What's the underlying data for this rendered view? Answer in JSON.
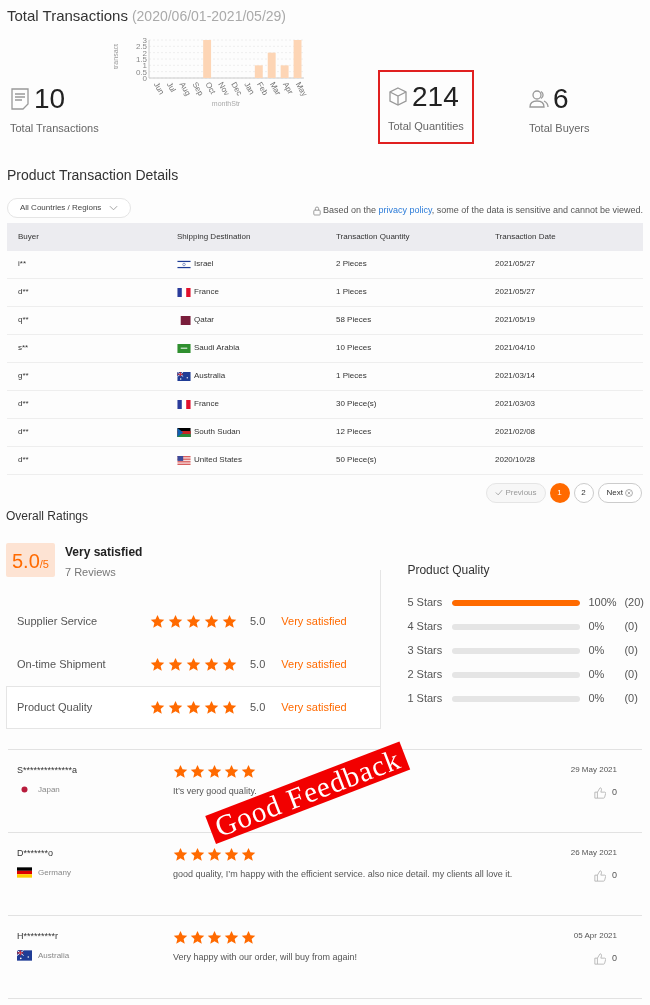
{
  "header": {
    "title": "Total Transactions",
    "range": "(2020/06/01-2021/05/29)"
  },
  "stats": [
    {
      "kind": "transactions",
      "value": "10",
      "label": "Total Transactions",
      "selected": false,
      "chart_data": {
        "type": "bar",
        "xlabel": "monthStr",
        "ylabel": "transact",
        "categories": [
          "Jun",
          "Jul",
          "Aug",
          "Sep",
          "Oct",
          "Nov",
          "Dec",
          "Jan",
          "Feb",
          "Mar",
          "Apr",
          "May"
        ],
        "grid": true,
        "series": [
          {
            "color": "#fdd5b5",
            "values": [
              0,
              0,
              0,
              0,
              3,
              0,
              0,
              0,
              1,
              2,
              1,
              3
            ]
          }
        ],
        "ylim": [
          0,
          3
        ],
        "yticks": [
          0,
          0.5,
          1,
          1.5,
          2,
          2.5,
          3
        ]
      }
    },
    {
      "kind": "quantities",
      "value": "214",
      "label": "Total Quantities",
      "selected": true
    },
    {
      "kind": "buyers",
      "value": "6",
      "label": "Total Buyers",
      "selected": false
    }
  ],
  "details": {
    "title": "Product Transaction Details",
    "filter": "All Countries / Regions",
    "notice_before": "Based on the",
    "notice_link": "privacy policy",
    "notice_after": ", some of the data is sensitive and cannot be viewed.",
    "columns": [
      "Buyer",
      "Shipping Destination",
      "Transaction Quantity",
      "Transaction Date"
    ],
    "rows": [
      {
        "buyer": "i**",
        "kind": "il",
        "country": "Israel",
        "quantity": "2 Pieces",
        "date": "2021/05/27"
      },
      {
        "buyer": "d**",
        "kind": "fr",
        "country": "France",
        "quantity": "1 Pieces",
        "date": "2021/05/27"
      },
      {
        "buyer": "q**",
        "kind": "qa",
        "country": "Qatar",
        "quantity": "58 Pieces",
        "date": "2021/05/19"
      },
      {
        "buyer": "s**",
        "kind": "sa",
        "country": "Saudi Arabia",
        "quantity": "10 Pieces",
        "date": "2021/04/10"
      },
      {
        "buyer": "g**",
        "kind": "au",
        "country": "Australia",
        "quantity": "1 Pieces",
        "date": "2021/03/14"
      },
      {
        "buyer": "d**",
        "kind": "fr",
        "country": "France",
        "quantity": "30 Piece(s)",
        "date": "2021/03/03"
      },
      {
        "buyer": "d**",
        "kind": "ss",
        "country": "South Sudan",
        "quantity": "12 Pieces",
        "date": "2021/02/08"
      },
      {
        "buyer": "d**",
        "kind": "us",
        "country": "United States",
        "quantity": "50 Piece(s)",
        "date": "2020/10/28"
      }
    ],
    "pagination": {
      "previous": "Previous",
      "previous_disabled": true,
      "pages": [
        {
          "label": "1",
          "selected": true
        },
        {
          "label": "2",
          "selected": false
        }
      ],
      "next": "Next"
    }
  },
  "ratings": {
    "title": "Overall Ratings",
    "score": "5.0",
    "out_of": "/5",
    "verdict": "Very satisfied",
    "reviews": "7 Reviews",
    "aspects": [
      {
        "name": "Supplier Service",
        "stars": 5,
        "score": "5.0",
        "verdict": "Very satisfied",
        "selected": false
      },
      {
        "name": "On-time Shipment",
        "stars": 5,
        "score": "5.0",
        "verdict": "Very satisfied",
        "selected": false
      },
      {
        "name": "Product Quality",
        "stars": 5,
        "score": "5.0",
        "verdict": "Very satisfied",
        "selected": true
      }
    ],
    "breakdown": {
      "title": "Product Quality",
      "rows": [
        {
          "label": "5 Stars",
          "level": 1,
          "percent": "100%",
          "count": "(20)"
        },
        {
          "label": "4 Stars",
          "level": 0,
          "percent": "0%",
          "count": "(0)"
        },
        {
          "label": "3 Stars",
          "level": 0,
          "percent": "0%",
          "count": "(0)"
        },
        {
          "label": "2 Stars",
          "level": 0,
          "percent": "0%",
          "count": "(0)"
        },
        {
          "label": "1 Stars",
          "level": 0,
          "percent": "0%",
          "count": "(0)"
        }
      ]
    }
  },
  "reviews": [
    {
      "name": "S**************a",
      "kind": "jp",
      "country": "Japan",
      "stars": 5,
      "text": "It’s very good quality.",
      "date": "29 May 2021",
      "likes": "0"
    },
    {
      "name": "D*******o",
      "kind": "de",
      "country": "Germany",
      "stars": 5,
      "text": "good quality, I’m happy with the efficient service.  also nice detail. my clients all love it.",
      "date": "26 May 2021",
      "likes": "0"
    },
    {
      "name": "H*********r",
      "kind": "au",
      "country": "Australia",
      "stars": 5,
      "text": "Very happy with our order, will buy from again!",
      "date": "05 Apr 2021",
      "likes": "0"
    }
  ],
  "stamp": "Good Feedback"
}
